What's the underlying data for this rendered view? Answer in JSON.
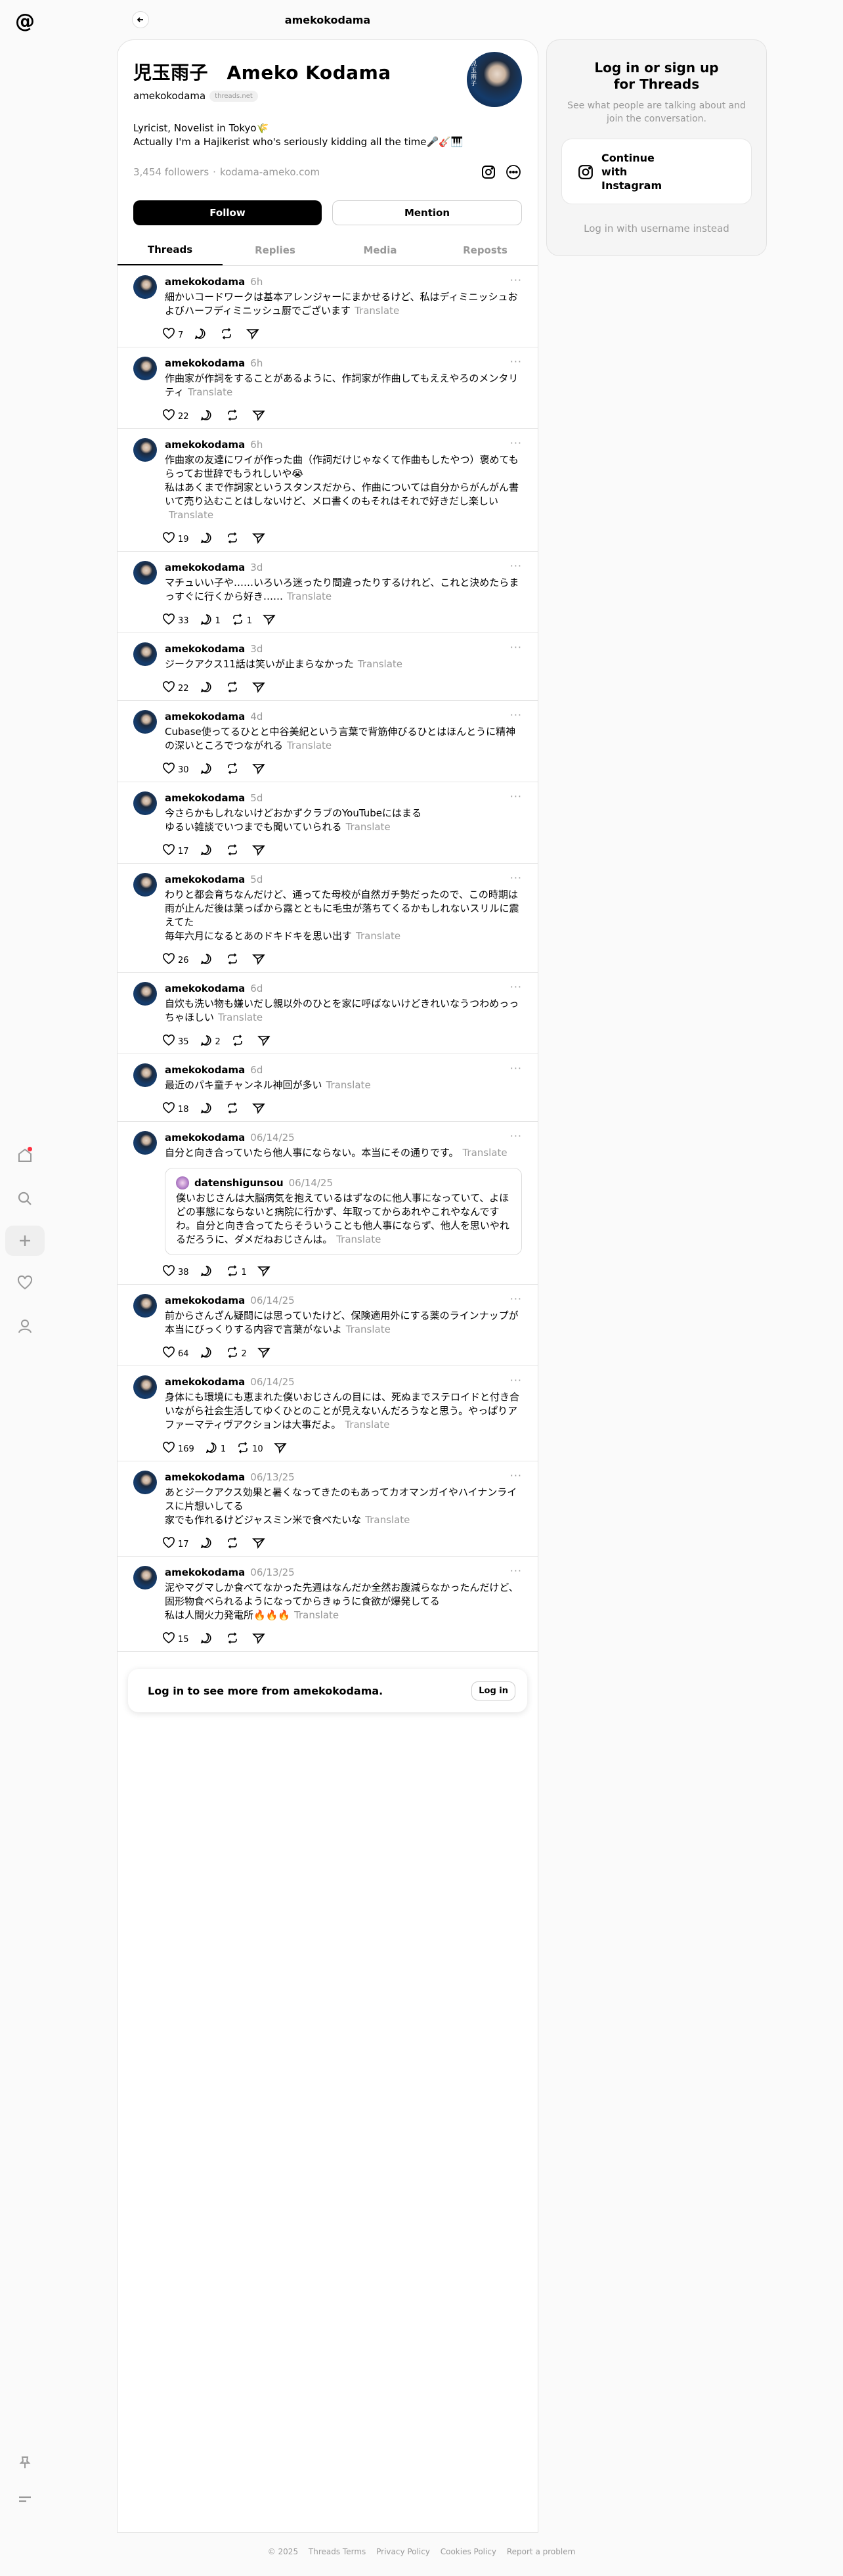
{
  "header": {
    "title": "amekokodama"
  },
  "profile": {
    "display_name": "児玉雨子　Ameko Kodama",
    "handle": "amekokodama",
    "badge": "threads.net",
    "avatar_text": "児玉雨子",
    "bio_line1": "Lyricist, Novelist in Tokyo🌾",
    "bio_line2": "Actually I'm a Hajikerist who's seriously kidding all the time🎤🎸🎹",
    "followers": "3,454 followers",
    "separator": "·",
    "website": "kodama-ameko.com",
    "follow_label": "Follow",
    "mention_label": "Mention"
  },
  "tabs": [
    "Threads",
    "Replies",
    "Media",
    "Reposts"
  ],
  "translate_label": "Translate",
  "posts": [
    {
      "user": "amekokodama",
      "time": "6h",
      "text": "細かいコードワークは基本アレンジャーにまかせるけど、私はディミニッシュおよびハーフディミニッシュ厨でございます",
      "likes": "7",
      "replies": "",
      "reposts": ""
    },
    {
      "user": "amekokodama",
      "time": "6h",
      "text": "作曲家が作詞をすることがあるように、作詞家が作曲してもええやろのメンタリティ",
      "likes": "22",
      "replies": "",
      "reposts": ""
    },
    {
      "user": "amekokodama",
      "time": "6h",
      "text": "作曲家の友達にワイが作った曲（作詞だけじゃなくて作曲もしたやつ）褒めてもらってお世辞でもうれしいや😭\n私はあくまで作詞家というスタンスだから、作曲については自分からがんがん書いて売り込むことはしないけど、メロ書くのもそれはそれで好きだし楽しい",
      "likes": "19",
      "replies": "",
      "reposts": ""
    },
    {
      "user": "amekokodama",
      "time": "3d",
      "text": "マチュいい子や……いろいろ迷ったり間違ったりするけれど、これと決めたらまっすぐに行くから好き……",
      "likes": "33",
      "replies": "1",
      "reposts": "1"
    },
    {
      "user": "amekokodama",
      "time": "3d",
      "text": "ジークアクス11話は笑いが止まらなかった",
      "likes": "22",
      "replies": "",
      "reposts": ""
    },
    {
      "user": "amekokodama",
      "time": "4d",
      "text": "Cubase使ってるひとと中谷美紀という言葉で背筋伸びるひとはほんとうに精神の深いところでつながれる",
      "likes": "30",
      "replies": "",
      "reposts": ""
    },
    {
      "user": "amekokodama",
      "time": "5d",
      "text": "今さらかもしれないけどおかずクラブのYouTubeにはまる\nゆるい雑談でいつまでも聞いていられる",
      "likes": "17",
      "replies": "",
      "reposts": ""
    },
    {
      "user": "amekokodama",
      "time": "5d",
      "text": "わりと都会育ちなんだけど、通ってた母校が自然ガチ勢だったので、この時期は雨が止んだ後は葉っぱから露とともに毛虫が落ちてくるかもしれないスリルに震えてた\n毎年六月になるとあのドキドキを思い出す",
      "likes": "26",
      "replies": "",
      "reposts": ""
    },
    {
      "user": "amekokodama",
      "time": "6d",
      "text": "自炊も洗い物も嫌いだし親以外のひとを家に呼ばないけどきれいなうつわめっっちゃほしい",
      "likes": "35",
      "replies": "2",
      "reposts": ""
    },
    {
      "user": "amekokodama",
      "time": "6d",
      "text": "最近のパキ童チャンネル神回が多い",
      "likes": "18",
      "replies": "",
      "reposts": ""
    },
    {
      "user": "amekokodama",
      "time": "06/14/25",
      "text": "自分と向き合っていたら他人事にならない。本当にその通りです。",
      "likes": "38",
      "replies": "",
      "reposts": "1",
      "quote": {
        "user": "datenshigunsou",
        "time": "06/14/25",
        "text": "僕いおじさんは大脳病気を抱えているはずなのに他人事になっていて、よほどの事態にならないと病院に行かず、年取ってからあれやこれやなんですわ。自分と向き合ってたらそういうことも他人事にならず、他人を思いやれるだろうに、ダメだねおじさんは。"
      }
    },
    {
      "user": "amekokodama",
      "time": "06/14/25",
      "text": "前からさんざん疑問には思っていたけど、保険適用外にする薬のラインナップが本当にびっくりする内容で言葉がないよ",
      "likes": "64",
      "replies": "",
      "reposts": "2"
    },
    {
      "user": "amekokodama",
      "time": "06/14/25",
      "text": "身体にも環境にも恵まれた僕いおじさんの目には、死ぬまでステロイドと付き合いながら社会生活してゆくひとのことが見えないんだろうなと思う。やっぱりアファーマティヴアクションは大事だよ。",
      "likes": "169",
      "replies": "1",
      "reposts": "10"
    },
    {
      "user": "amekokodama",
      "time": "06/13/25",
      "text": "あとジークアクス効果と暑くなってきたのもあってカオマンガイやハイナンライスに片想いしてる\n家でも作れるけどジャスミン米で食べたいな",
      "likes": "17",
      "replies": "",
      "reposts": ""
    },
    {
      "user": "amekokodama",
      "time": "06/13/25",
      "text": "泥やマグマしか食べてなかった先週はなんだか全然お腹減らなかったんだけど、固形物食べられるようになってからきゅうに食欲が爆発してる\n私は人間火力発電所🔥🔥🔥",
      "likes": "15",
      "replies": "",
      "reposts": ""
    }
  ],
  "login_more": {
    "text": "Log in to see more from amekokodama.",
    "button": "Log in"
  },
  "side": {
    "title": "Log in or sign up for Threads",
    "subtitle": "See what people are talking about and join the conversation.",
    "instagram_label": "Continue with Instagram",
    "username_link": "Log in with username instead"
  },
  "footer": [
    "© 2025",
    "Threads Terms",
    "Privacy Policy",
    "Cookies Policy",
    "Report a problem"
  ],
  "nav_icons": [
    "threads-logo",
    "home-icon",
    "search-icon",
    "plus-icon",
    "heart-icon",
    "user-icon",
    "pin-icon",
    "menu-icon"
  ]
}
